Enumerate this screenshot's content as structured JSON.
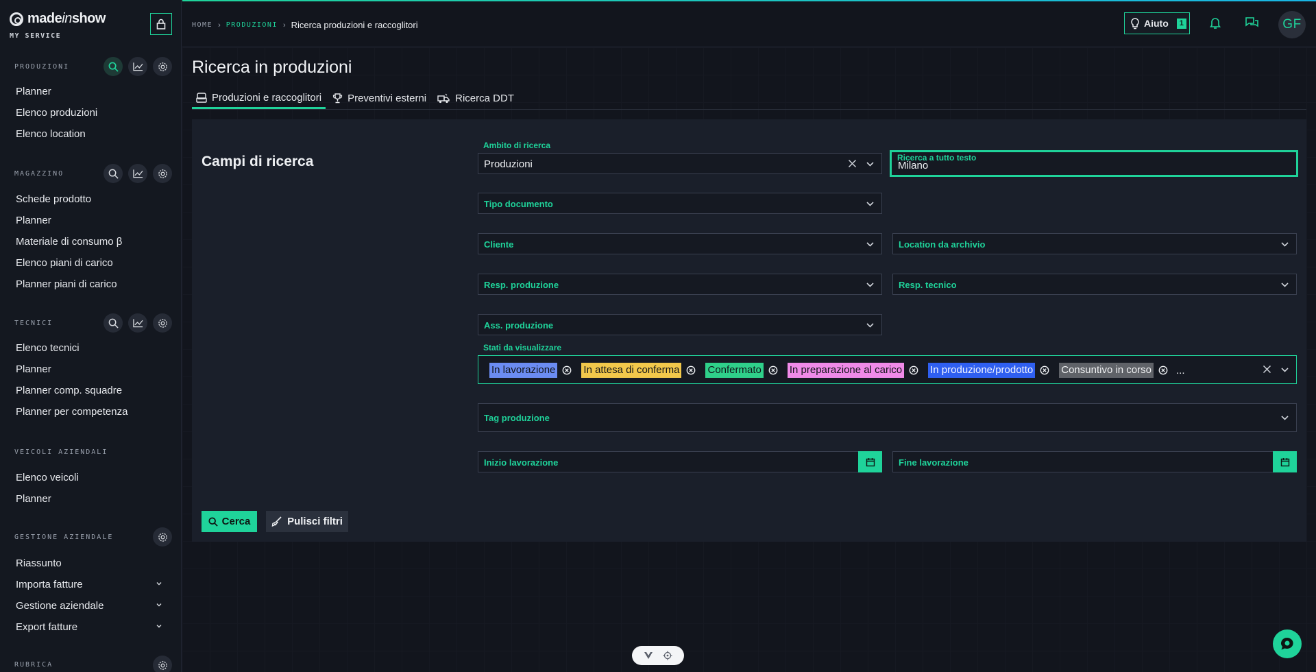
{
  "brand": {
    "name_pre": "made",
    "name_in": "in",
    "name_post": "show",
    "subtitle": "MY SERVICE"
  },
  "sidebar": {
    "sections": [
      {
        "title": "PRODUZIONI",
        "items": [
          "Planner",
          "Elenco produzioni",
          "Elenco location"
        ]
      },
      {
        "title": "MAGAZZINO",
        "items": [
          "Schede prodotto",
          "Planner",
          "Materiale di consumo β",
          "Elenco piani di carico",
          "Planner piani di carico"
        ]
      },
      {
        "title": "TECNICI",
        "items": [
          "Elenco tecnici",
          "Planner",
          "Planner comp. squadre",
          "Planner per competenza"
        ]
      },
      {
        "title": "VEICOLI AZIENDALI",
        "items": [
          "Elenco veicoli",
          "Planner"
        ]
      },
      {
        "title": "GESTIONE AZIENDALE",
        "items": [
          "Riassunto",
          "Importa fatture",
          "Gestione aziendale",
          "Export fatture"
        ]
      },
      {
        "title": "RUBRICA",
        "items": []
      }
    ]
  },
  "header": {
    "breadcrumb": {
      "home": "HOME",
      "section": "PRODUZIONI",
      "current": "Ricerca produzioni e raccoglitori"
    },
    "help_label": "Aiuto",
    "help_badge": "1",
    "avatar_initials": "GF"
  },
  "page": {
    "title": "Ricerca in produzioni",
    "tabs": [
      "Produzioni e raccoglitori",
      "Preventivi esterni",
      "Ricerca DDT"
    ]
  },
  "form": {
    "panel_title": "Campi di ricerca",
    "ambito_label": "Ambito di ricerca",
    "ambito_value": "Produzioni",
    "fulltext_label": "Ricerca a tutto testo",
    "fulltext_value": "Milano",
    "tipo_documento": "Tipo documento",
    "cliente": "Cliente",
    "location": "Location da archivio",
    "resp_produzione": "Resp. produzione",
    "resp_tecnico": "Resp. tecnico",
    "ass_produzione": "Ass. produzione",
    "stati_label": "Stati da visualizzare",
    "stati": [
      {
        "label": "In lavorazione",
        "color": "#6b8cf2"
      },
      {
        "label": "In attesa di conferma",
        "color": "#f2c84b"
      },
      {
        "label": "Confermato",
        "color": "#2fd08a"
      },
      {
        "label": "In preparazione al carico",
        "color": "#f08ae8"
      },
      {
        "label": "In produzione/prodotto",
        "color": "#2f5ff0"
      },
      {
        "label": "Consuntivo in corso",
        "color": "#5f6268"
      }
    ],
    "stati_more": "...",
    "tag_produzione": "Tag produzione",
    "inizio_lavorazione": "Inizio lavorazione",
    "fine_lavorazione": "Fine lavorazione",
    "cerca": "Cerca",
    "pulisci": "Pulisci filtri"
  },
  "colors": {
    "accent": "#1fd39a",
    "background": "#12151d",
    "panel": "#1a1f2a"
  }
}
